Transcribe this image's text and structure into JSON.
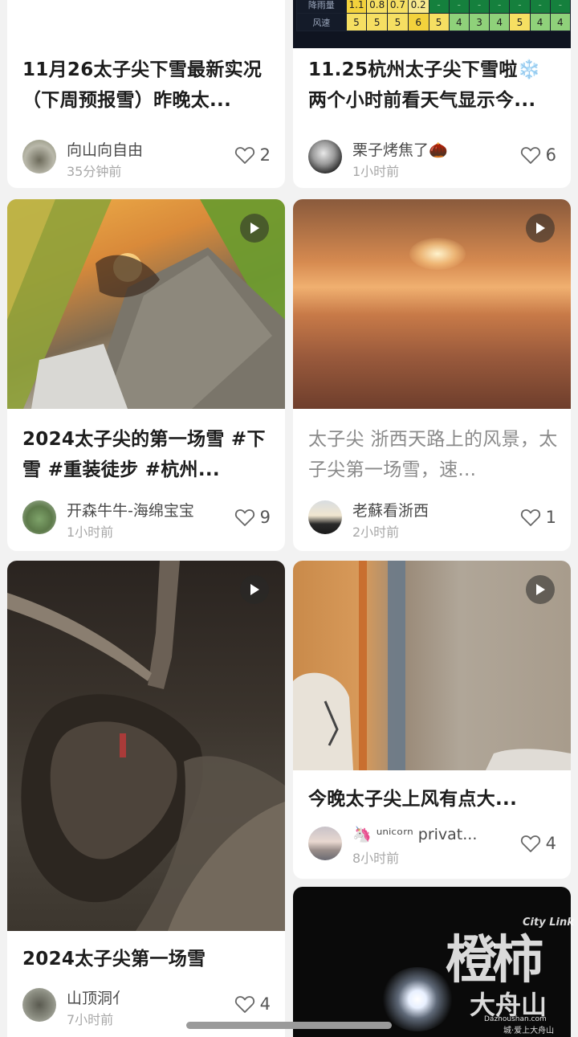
{
  "cards": [
    {
      "title": "11月26太子尖下雪最新实况（下周预报雪）昨晚太...",
      "author": "向山向自由",
      "time": "35分钟前",
      "likes": "2"
    },
    {
      "title": "11.25杭州太子尖下雪啦❄️两个小时前看天气显示今...",
      "author": "栗子烤焦了🌰",
      "time": "1小时前",
      "likes": "6",
      "weather_table": {
        "rows": [
          {
            "label": "降雨量",
            "values": [
              "1.1",
              "0.8",
              "0.7",
              "0.2",
              "-",
              "-",
              "-",
              "-",
              "-",
              "-",
              "-"
            ]
          },
          {
            "label": "风速",
            "values": [
              "5",
              "5",
              "5",
              "6",
              "5",
              "4",
              "3",
              "4",
              "5",
              "4",
              "4"
            ]
          }
        ]
      }
    },
    {
      "title": "2024太子尖的第一场雪 #下雪 #重装徒步 #杭州...",
      "author": "开森牛牛-海绵宝宝",
      "time": "1小时前",
      "likes": "9"
    },
    {
      "title": "太子尖 浙西天路上的风景，太子尖第一场雪，速...",
      "author": "老蘇看浙西",
      "time": "2小时前",
      "likes": "1"
    },
    {
      "title": "2024太子尖第一场雪",
      "author": "山顶洞亻",
      "time": "7小时前",
      "likes": "4"
    },
    {
      "title": "今晚太子尖上风有点大...",
      "author": "🦄 ᵘⁿⁱᶜᵒʳⁿ privat...",
      "time": "8小时前",
      "likes": "4"
    }
  ],
  "watermark": {
    "brand": "橙柿",
    "brand_en": "City Link",
    "site": "大舟山",
    "domain": "Dazhoushan.com",
    "footer": "城·爱上大舟山"
  },
  "icons": {
    "like": "heart-outline-icon",
    "video": "play-icon"
  },
  "colors": {
    "background": "#f2f2f2",
    "card": "#ffffff",
    "title": "#1c1c1c",
    "meta": "#a8a8a8"
  }
}
